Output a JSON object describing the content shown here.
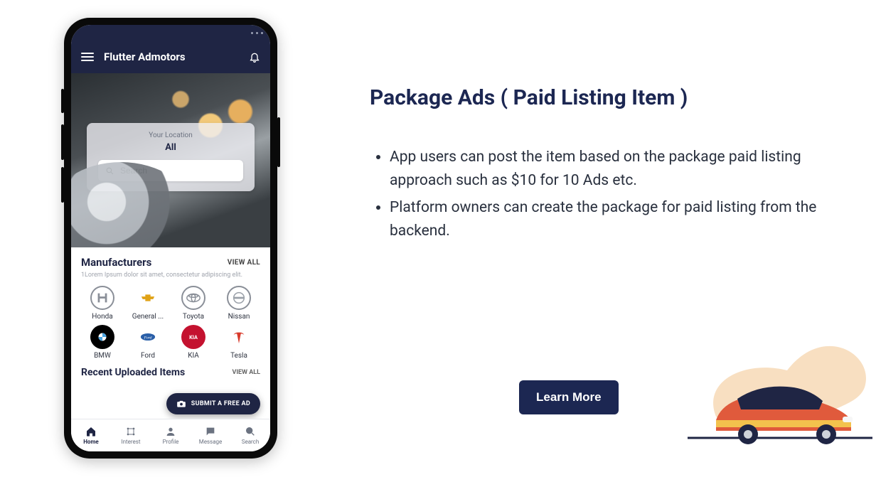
{
  "right": {
    "heading": "Package Ads ( Paid Listing Item )",
    "bullets": [
      "App users can post the item based on the package paid listing approach such as $10 for 10 Ads etc.",
      "Platform owners can create the package for paid listing from the backend."
    ],
    "learn_more": "Learn More"
  },
  "phone": {
    "app_title": "Flutter Admotors",
    "location": {
      "label": "Your Location",
      "value": "All",
      "search_placeholder": "Search"
    },
    "manufacturers": {
      "title": "Manufacturers",
      "view_all": "VIEW ALL",
      "lorem": "1Lorem Ipsum dolor sit amet, consectetur adipiscing elit.",
      "items": [
        {
          "name": "Honda"
        },
        {
          "name": "General ..."
        },
        {
          "name": "Toyota"
        },
        {
          "name": "Nissan"
        },
        {
          "name": "BMW"
        },
        {
          "name": "Ford"
        },
        {
          "name": "KIA"
        },
        {
          "name": "Tesla"
        }
      ]
    },
    "recent": {
      "title": "Recent Uploaded Items",
      "view_all": "VIEW ALL"
    },
    "fab": "SUBMIT A FREE AD",
    "nav": [
      {
        "label": "Home"
      },
      {
        "label": "Interest"
      },
      {
        "label": "Profile"
      },
      {
        "label": "Message"
      },
      {
        "label": "Search"
      }
    ]
  }
}
